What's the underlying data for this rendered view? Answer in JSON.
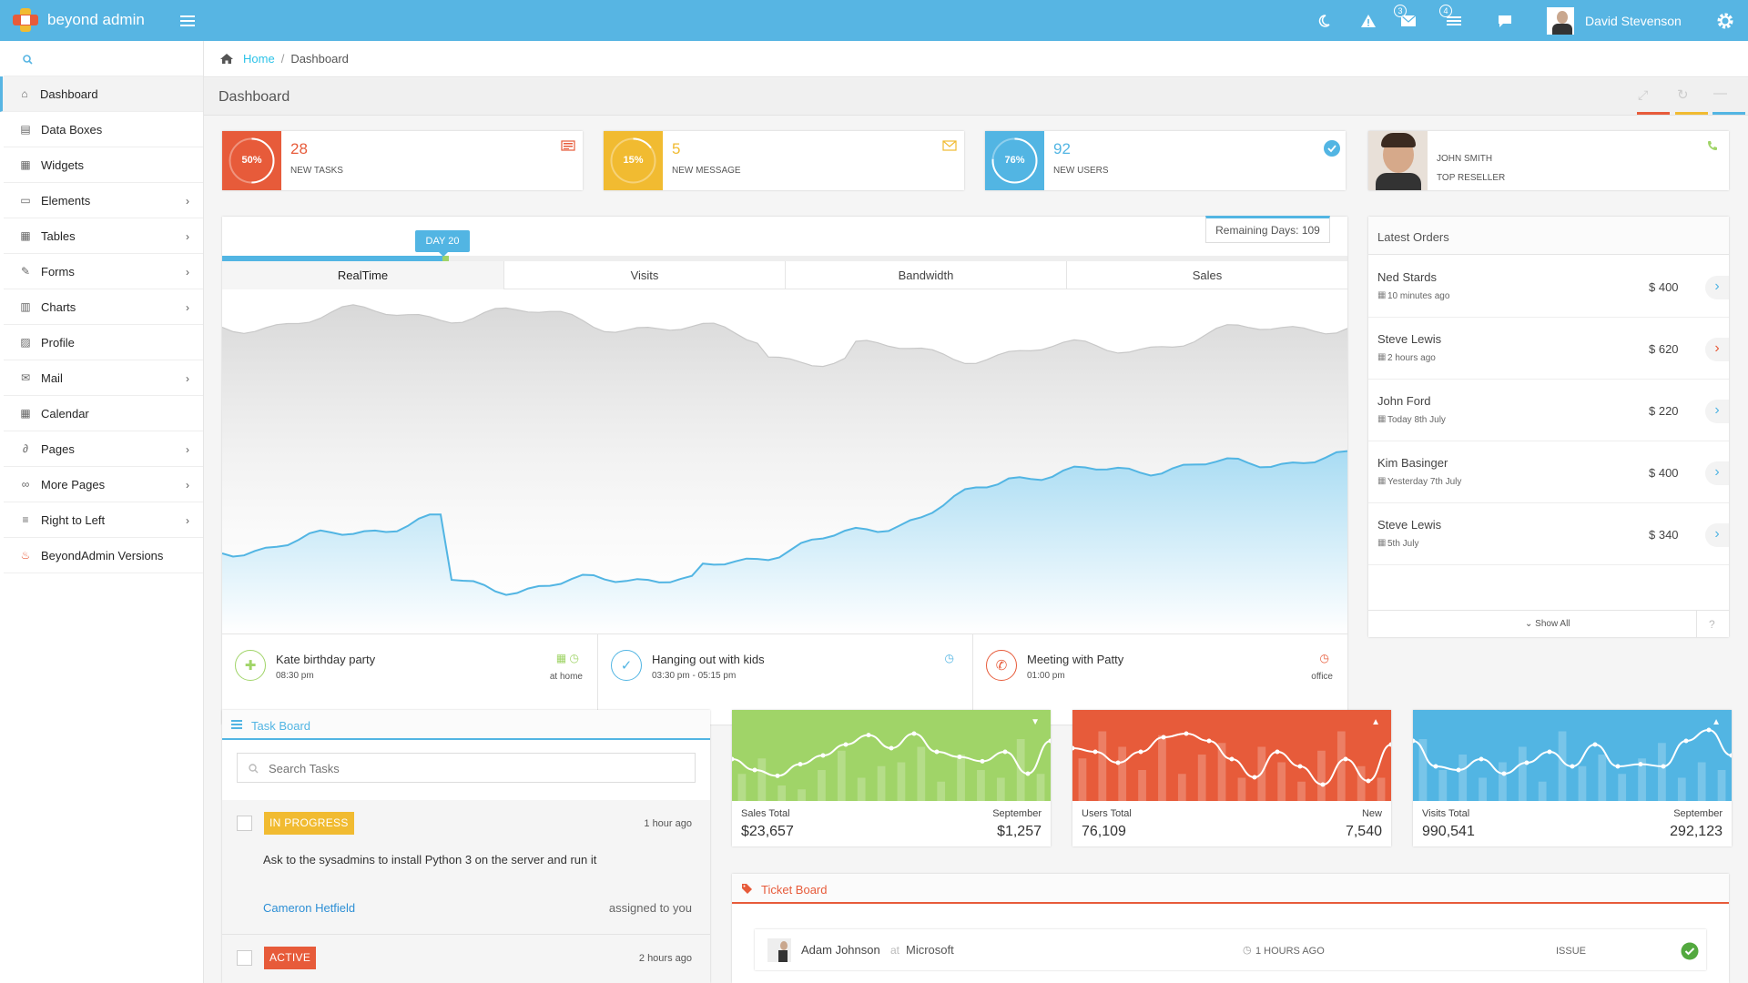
{
  "navbar": {
    "brand": "beyond admin",
    "user_name": "David Stevenson",
    "mail_count": "3",
    "task_count": "4"
  },
  "sidebar": {
    "search_placeholder": "",
    "items": [
      {
        "label": "Dashboard",
        "icon": "home-icon",
        "chevron": false,
        "active": true
      },
      {
        "label": "Data Boxes",
        "icon": "data-boxes-icon",
        "chevron": false
      },
      {
        "label": "Widgets",
        "icon": "widgets-icon",
        "chevron": false
      },
      {
        "label": "Elements",
        "icon": "desktop-icon",
        "chevron": true
      },
      {
        "label": "Tables",
        "icon": "table-icon",
        "chevron": true
      },
      {
        "label": "Forms",
        "icon": "edit-icon",
        "chevron": true
      },
      {
        "label": "Charts",
        "icon": "bar-chart-icon",
        "chevron": true
      },
      {
        "label": "Profile",
        "icon": "picture-icon",
        "chevron": false
      },
      {
        "label": "Mail",
        "icon": "envelope-icon",
        "chevron": true
      },
      {
        "label": "Calendar",
        "icon": "calendar-icon",
        "chevron": false
      },
      {
        "label": "Pages",
        "icon": "paperclip-icon",
        "chevron": true
      },
      {
        "label": "More Pages",
        "icon": "link-icon",
        "chevron": true
      },
      {
        "label": "Right to Left",
        "icon": "align-right-icon",
        "chevron": true
      },
      {
        "label": "BeyondAdmin Versions",
        "icon": "fire-icon",
        "chevron": false
      }
    ]
  },
  "breadcrumb": {
    "home": "Home",
    "current": "Dashboard"
  },
  "page_title": "Dashboard",
  "colors": {
    "red": "#e75b3a",
    "yellow": "#f1bb31",
    "blue": "#52b5e3",
    "green": "#a0d468",
    "brand": "#57b5e3"
  },
  "stats": [
    {
      "percent": "50%",
      "value": "28",
      "label": "NEW TASKS",
      "color": "#e75b3a",
      "progress": 0.5,
      "icon": "tasks-icon"
    },
    {
      "percent": "15%",
      "value": "5",
      "label": "NEW MESSAGE",
      "color": "#f1bb31",
      "progress": 0.15,
      "icon": "envelope-icon"
    },
    {
      "percent": "76%",
      "value": "92",
      "label": "NEW USERS",
      "color": "#52b5e3",
      "progress": 0.76,
      "icon": "check-circle-icon"
    }
  ],
  "reseller": {
    "name": "JOHN SMITH",
    "title": "TOP RESELLER"
  },
  "realtime": {
    "day_badge": "DAY 20",
    "remaining": "Remaining Days: 109",
    "tabs": [
      "RealTime",
      "Visits",
      "Bandwidth",
      "Sales"
    ],
    "active_tab": 0
  },
  "events": [
    {
      "title": "Kate birthday party",
      "time": "08:30 pm",
      "place": "at home",
      "color": "#a0d468"
    },
    {
      "title": "Hanging out with kids",
      "time": "03:30 pm - 05:15 pm",
      "place": "",
      "color": "#52b5e3"
    },
    {
      "title": "Meeting with Patty",
      "time": "01:00 pm",
      "place": "office",
      "color": "#e75b3a"
    }
  ],
  "orders": {
    "title": "Latest Orders",
    "show_all": "Show All",
    "help": "?",
    "items": [
      {
        "name": "Ned Stards",
        "time": "10 minutes ago",
        "amount": "$ 400",
        "color": "#52b5e3"
      },
      {
        "name": "Steve Lewis",
        "time": "2 hours ago",
        "amount": "$ 620",
        "color": "#e75b3a"
      },
      {
        "name": "John Ford",
        "time": "Today 8th July",
        "amount": "$ 220",
        "color": "#52b5e3"
      },
      {
        "name": "Kim Basinger",
        "time": "Yesterday 7th July",
        "amount": "$ 400",
        "color": "#52b5e3"
      },
      {
        "name": "Steve Lewis",
        "time": "5th July",
        "amount": "$ 340",
        "color": "#52b5e3"
      }
    ]
  },
  "taskboard": {
    "title": "Task Board",
    "search_placeholder": "Search Tasks",
    "tasks": [
      {
        "status": "IN PROGRESS",
        "status_color": "#f1bb31",
        "time": "1 hour ago",
        "text": "Ask to the sysadmins to install Python 3 on the server and run it",
        "user": "Cameron Hetfield",
        "assigned": "assigned to you"
      },
      {
        "status": "ACTIVE",
        "status_color": "#e75b3a",
        "time": "2 hours ago"
      }
    ]
  },
  "minicharts": [
    {
      "left_label": "Sales Total",
      "left_value": "$23,657",
      "right_label": "September",
      "right_value": "$1,257",
      "color": "#a0d468",
      "caret": "down"
    },
    {
      "left_label": "Users Total",
      "left_value": "76,109",
      "right_label": "New",
      "right_value": "7,540",
      "color": "#e75b3a",
      "caret": "up"
    },
    {
      "left_label": "Visits Total",
      "left_value": "990,541",
      "right_label": "September",
      "right_value": "292,123",
      "color": "#52b5e3",
      "caret": "up"
    }
  ],
  "ticketboard": {
    "title": "Ticket Board",
    "tickets": [
      {
        "name": "Adam Johnson",
        "at": "at",
        "company": "Microsoft",
        "time": "1 HOURS AGO",
        "type": "ISSUE"
      }
    ]
  }
}
